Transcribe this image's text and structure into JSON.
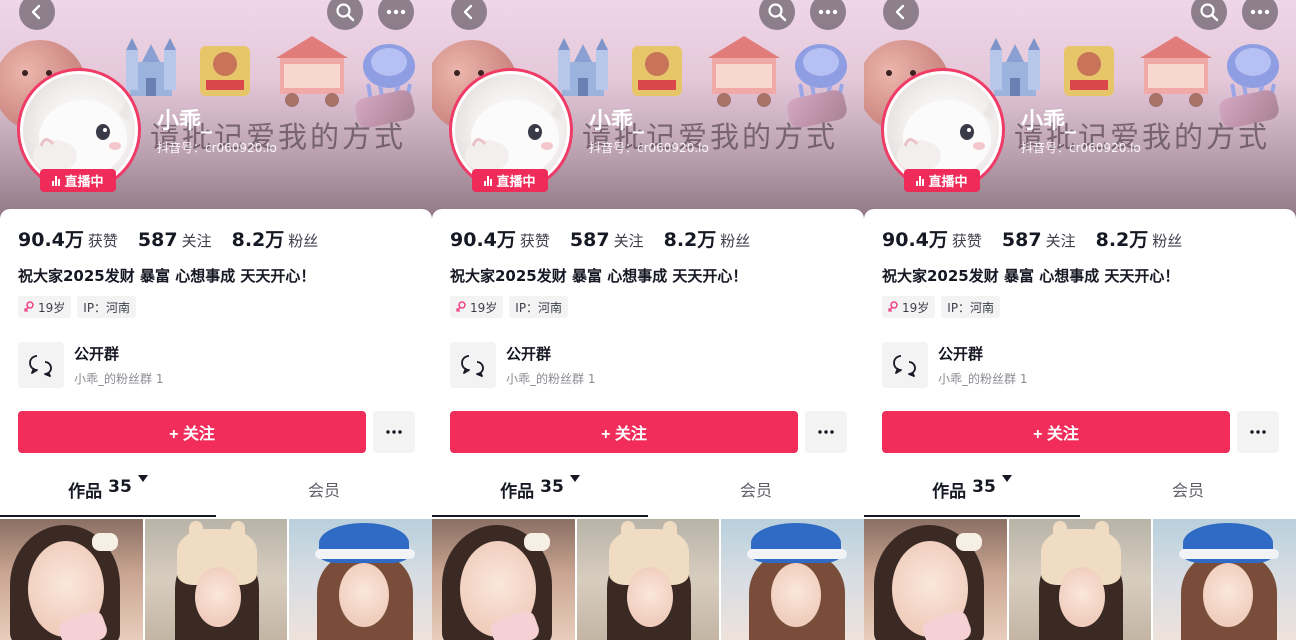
{
  "profile": {
    "nickname": "小乖_",
    "account_id": "抖音号：cr060920.lo",
    "banner_text": "请批记爱我的方式",
    "live_badge": "直播中",
    "stats": [
      {
        "num": "90.4万",
        "label": "获赞"
      },
      {
        "num": "587",
        "label": "关注"
      },
      {
        "num": "8.2万",
        "label": "粉丝"
      }
    ],
    "bio": "祝大家2025发财 暴富 心想事成 天天开心！",
    "tags": {
      "age": "19岁",
      "ip": "IP：河南"
    },
    "group": {
      "title": "公开群",
      "subtitle": "小乖_的粉丝群 1"
    },
    "follow_label": "+ 关注",
    "more_label": "···",
    "tabs": {
      "works_label": "作品",
      "works_count": "35",
      "member_label": "会员"
    }
  },
  "colors": {
    "accent": "#F22D5C",
    "live": "#EE2B59",
    "text_primary": "#161823",
    "text_secondary": "#8A8B91",
    "chip_bg": "#F3F3F4"
  },
  "icons": [
    "back-icon",
    "search-icon",
    "more-icon",
    "live-bars-icon",
    "female-icon",
    "group-chat-icon",
    "dropdown-caret-icon"
  ],
  "panels": [
    {
      "name": "profile-panel-1"
    },
    {
      "name": "profile-panel-2"
    },
    {
      "name": "profile-panel-3"
    }
  ]
}
